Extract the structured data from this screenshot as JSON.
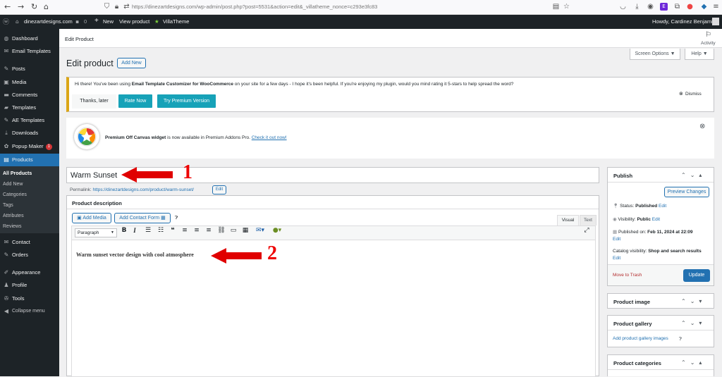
{
  "browser": {
    "url": "https://dinezartdesigns.com/wp-admin/post.php?post=5531&action=edit&_villatheme_nonce=c293e3fc83"
  },
  "adminbar": {
    "site": "dinezartdesigns.com",
    "comments_count": "0",
    "new_label": "New",
    "view_label": "View product",
    "villa_label": "VillaTheme",
    "howdy": "Howdy, Cardinez Benjamin"
  },
  "sidebar": {
    "items": [
      {
        "label": "Dashboard",
        "icon": "dashboard-icon"
      },
      {
        "label": "Email Templates",
        "icon": "email-icon"
      },
      {
        "label": "Posts",
        "icon": "pin-icon"
      },
      {
        "label": "Media",
        "icon": "media-icon"
      },
      {
        "label": "Comments",
        "icon": "comment-icon"
      },
      {
        "label": "Templates",
        "icon": "folder-icon"
      },
      {
        "label": "AE Templates",
        "icon": "pin-icon"
      },
      {
        "label": "Downloads",
        "icon": "download-icon"
      },
      {
        "label": "Popup Maker",
        "icon": "popup-icon",
        "badge": "1"
      },
      {
        "label": "Products",
        "icon": "products-icon"
      }
    ],
    "submenu": [
      "All Products",
      "Add New",
      "Categories",
      "Tags",
      "Attributes",
      "Reviews"
    ],
    "lower": [
      {
        "label": "Contact",
        "icon": "email-icon"
      },
      {
        "label": "Orders",
        "icon": "pin-icon"
      },
      {
        "label": "Appearance",
        "icon": "brush-icon"
      },
      {
        "label": "Profile",
        "icon": "user-icon"
      },
      {
        "label": "Tools",
        "icon": "wrench-icon"
      },
      {
        "label": "Collapse menu",
        "icon": "collapse-icon"
      }
    ]
  },
  "header": {
    "breadcrumb": "Edit Product",
    "activity": "Activity",
    "screen_options": "Screen Options ▼",
    "help": "Help ▼"
  },
  "page": {
    "title": "Edit product",
    "add_new": "Add New"
  },
  "notice": {
    "text_before": "Hi there! You've been using ",
    "plugin": "Email Template Customizer for WooCommerce",
    "text_after": " on your site for a few days - I hope it's been helpful. If you're enjoying my plugin, would you mind rating it 5-stars to help spread the word?",
    "thanks": "Thanks, later",
    "rate": "Rate Now",
    "premium": "Try Premium Version",
    "dismiss": "Dismiss"
  },
  "promo": {
    "bold": "Premium Off Canvas widget",
    "text": " is now available in Premium Addons Pro. ",
    "link": "Check it out now!"
  },
  "editor": {
    "title_value": "Warm Sunset",
    "permalink_label": "Permalink:",
    "permalink_url": "https://dinezartdesigns.com/product/warm-sunset/",
    "edit": "Edit",
    "description_label": "Product description",
    "add_media": "Add Media",
    "add_contact": "Add Contact Form",
    "tab_visual": "Visual",
    "tab_text": "Text",
    "format": "Paragraph",
    "content": "Warm sunset vector design with cool atmosphere"
  },
  "annotations": {
    "one": "1",
    "two": "2"
  },
  "publish": {
    "title": "Publish",
    "preview": "Preview Changes",
    "status_label": "Status: ",
    "status_value": "Published",
    "visibility_label": "Visibility: ",
    "visibility_value": "Public",
    "published_label": "Published on: ",
    "published_value": "Feb 11, 2024 at 22:09",
    "catalog_label": "Catalog visibility: ",
    "catalog_value": "Shop and search results",
    "edit": "Edit",
    "trash": "Move to Trash",
    "update": "Update"
  },
  "product_image": {
    "title": "Product image"
  },
  "product_gallery": {
    "title": "Product gallery",
    "link": "Add product gallery images"
  },
  "product_categories": {
    "title": "Product categories"
  },
  "colors": {
    "admin_dark": "#1d2327",
    "accent_blue": "#2271b1",
    "teal": "#17a2b8",
    "annotation_red": "#e00000"
  }
}
